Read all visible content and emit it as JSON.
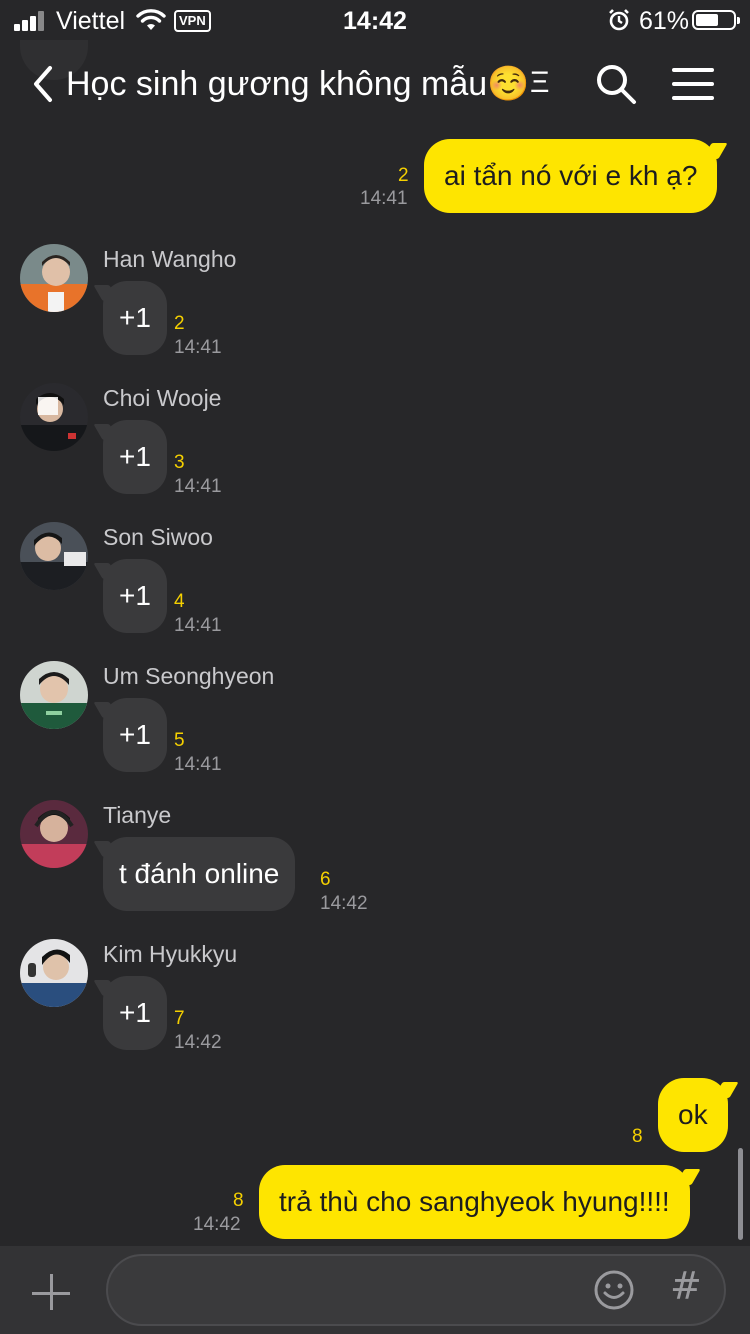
{
  "status_bar": {
    "carrier": "Viettel",
    "vpn": "VPN",
    "time": "14:42",
    "battery": "61%",
    "battery_level": 0.61
  },
  "header": {
    "title": "Học sinh gương không mẫu☺️",
    "extra": "Ξ"
  },
  "messages": {
    "m1": {
      "text": "ai tẩn nó với e kh ạ?",
      "unread": "2",
      "time": "14:41"
    },
    "m2": {
      "sender": "Han Wangho",
      "text": "+1",
      "unread": "2",
      "time": "14:41"
    },
    "m3": {
      "sender": "Choi Wooje",
      "text": "+1",
      "unread": "3",
      "time": "14:41"
    },
    "m4": {
      "sender": "Son Siwoo",
      "text": "+1",
      "unread": "4",
      "time": "14:41"
    },
    "m5": {
      "sender": "Um Seonghyeon",
      "text": "+1",
      "unread": "5",
      "time": "14:41"
    },
    "m6": {
      "sender": "Tianye",
      "text": "t đánh online",
      "unread": "6",
      "time": "14:42"
    },
    "m7": {
      "sender": "Kim Hyukkyu",
      "text": "+1",
      "unread": "7",
      "time": "14:42"
    },
    "m8": {
      "text": "ok",
      "unread": "8"
    },
    "m9": {
      "text": "trả thù cho sanghyeok hyung!!!!",
      "unread": "8",
      "time": "14:42"
    }
  },
  "input": {
    "placeholder": "",
    "hash": "#"
  },
  "colors": {
    "background": "#272729",
    "my_bubble": "#fee500",
    "their_bubble": "#3a3a3c",
    "unread_count": "#f5d000"
  }
}
